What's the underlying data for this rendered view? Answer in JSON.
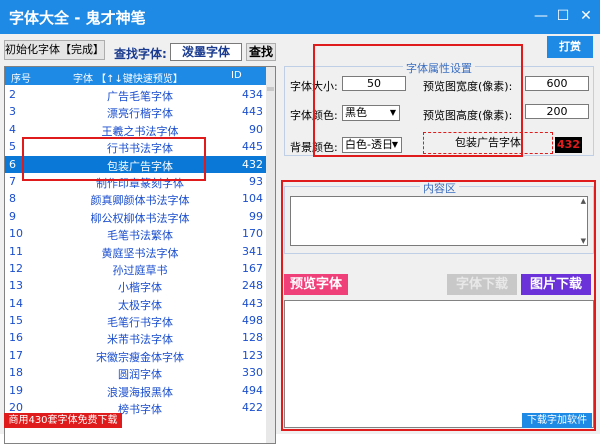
{
  "window": {
    "title": "字体大全 - 鬼才神笔",
    "min": "—",
    "max": "☐",
    "close": "✕"
  },
  "toolbar": {
    "init_button": "初始化字体【完成】",
    "search_label": "查找字体:",
    "search_value": "泼墨字体",
    "search_button": "查找",
    "tip_button": "打赏"
  },
  "font_list": {
    "headers": {
      "no": "序号",
      "font": "字体 【↑↓键快速预览】",
      "id": "ID"
    },
    "rows": [
      {
        "no": "2",
        "name": "广告毛笔字体",
        "id": "434"
      },
      {
        "no": "3",
        "name": "漂亮行楷字体",
        "id": "443"
      },
      {
        "no": "4",
        "name": "王羲之书法字体",
        "id": "90"
      },
      {
        "no": "5",
        "name": "行书书法字体",
        "id": "445"
      },
      {
        "no": "6",
        "name": "包装广告字体",
        "id": "432"
      },
      {
        "no": "7",
        "name": "制作印章篆刻字体",
        "id": "93"
      },
      {
        "no": "8",
        "name": "颜真卿颜体书法字体",
        "id": "104"
      },
      {
        "no": "9",
        "name": "柳公权柳体书法字体",
        "id": "99"
      },
      {
        "no": "10",
        "name": "毛笔书法繁体",
        "id": "170"
      },
      {
        "no": "11",
        "name": "黄庭坚书法字体",
        "id": "341"
      },
      {
        "no": "12",
        "name": "孙过庭草书",
        "id": "167"
      },
      {
        "no": "13",
        "name": "小楷字体",
        "id": "248"
      },
      {
        "no": "14",
        "name": "太极字体",
        "id": "443"
      },
      {
        "no": "15",
        "name": "毛笔行书字体",
        "id": "498"
      },
      {
        "no": "16",
        "name": "米芾书法字体",
        "id": "128"
      },
      {
        "no": "17",
        "name": "宋徽宗瘦金体字体",
        "id": "123"
      },
      {
        "no": "18",
        "name": "圆润字体",
        "id": "330"
      },
      {
        "no": "19",
        "name": "浪漫海报黑体",
        "id": "494"
      },
      {
        "no": "20",
        "name": "榜书字体",
        "id": "422"
      }
    ],
    "selected_index": 4
  },
  "free_download": "商用430套字体免费下载",
  "properties": {
    "legend": "字体属性设置",
    "size_label": "字体大小:",
    "size_value": "50",
    "width_label": "预览图宽度(像素):",
    "width_value": "600",
    "color_label": "字体颜色:",
    "color_value": "黑色",
    "height_label": "预览图高度(像素):",
    "height_value": "200",
    "bg_label": "背景颜色:",
    "bg_value": "白色-透日",
    "current_font": "包装广告字体",
    "current_id": "432"
  },
  "content_area": {
    "legend": "内容区"
  },
  "actions": {
    "preview": "预览字体",
    "font_download": "字体下载",
    "image_download": "图片下载",
    "download_software": "下载字加软件"
  },
  "colors": {
    "accent": "#1e8ae6",
    "highlight": "#e01b1b",
    "preview": "#f0407a",
    "image_dl": "#6a32d8"
  }
}
